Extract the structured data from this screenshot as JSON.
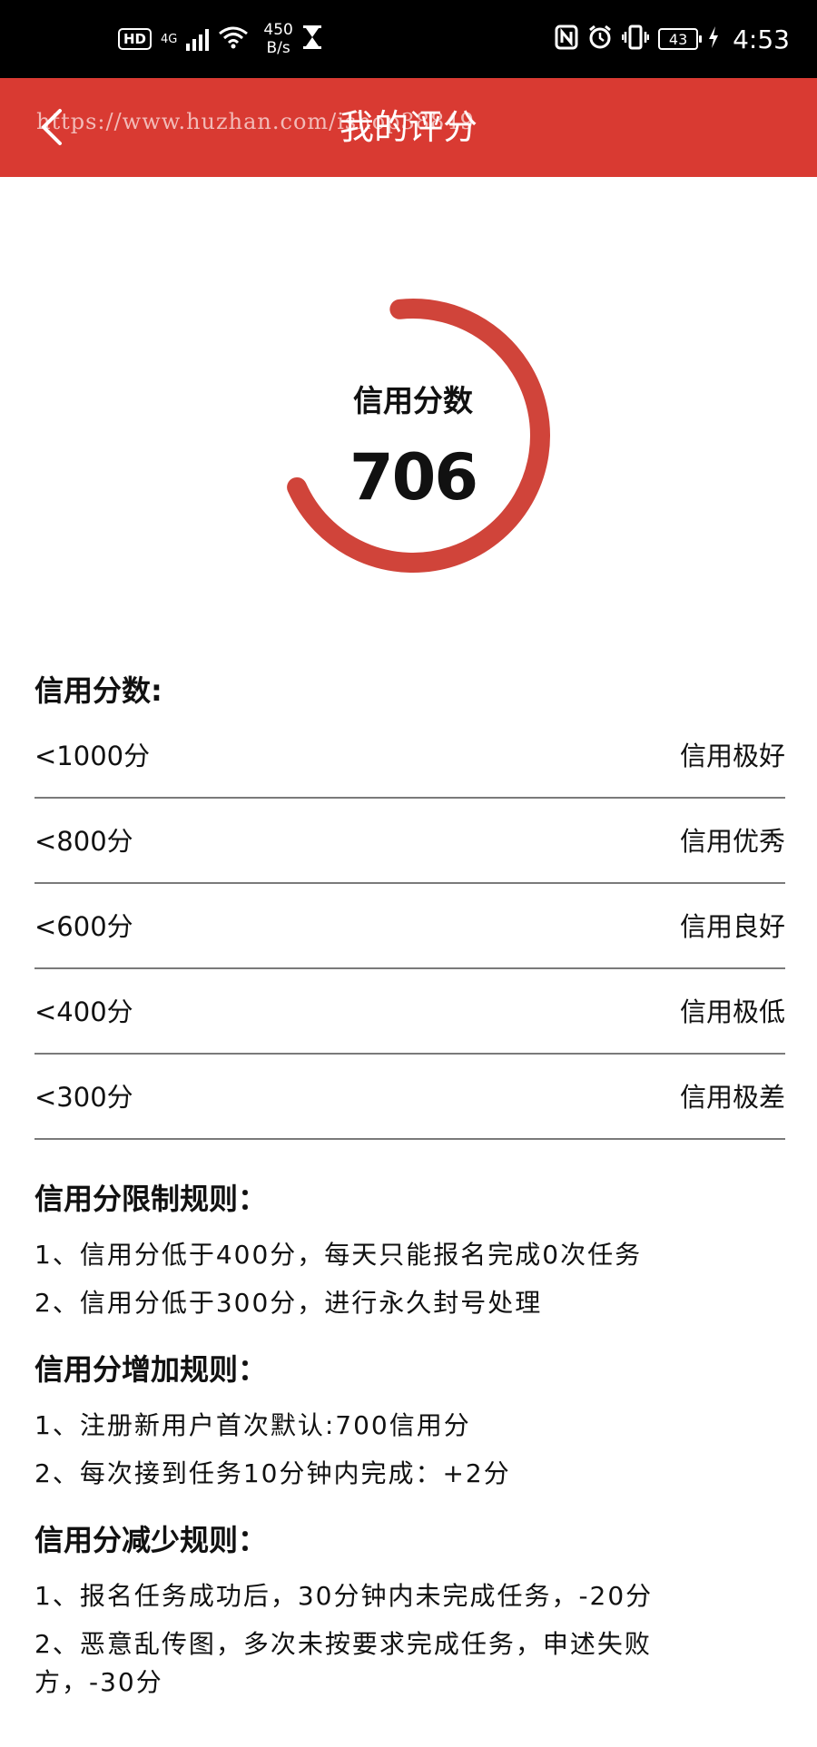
{
  "status_bar": {
    "hd": "HD",
    "network": "4G",
    "speed_value": "450",
    "speed_unit": "B/s",
    "battery": "43",
    "time": "4:53"
  },
  "header": {
    "title": "我的评分",
    "watermark": "https://www.huzhan.com/ishop38849"
  },
  "score": {
    "label": "信用分数",
    "value": "706",
    "ring_fraction": 0.7,
    "ring_color": "#d0443a"
  },
  "levels": {
    "title": "信用分数:",
    "rows": [
      {
        "score": "<1000分",
        "desc": "信用极好"
      },
      {
        "score": "<800分",
        "desc": "信用优秀"
      },
      {
        "score": "<600分",
        "desc": "信用良好"
      },
      {
        "score": "<400分",
        "desc": "信用极低"
      },
      {
        "score": "<300分",
        "desc": "信用极差"
      }
    ]
  },
  "rules": {
    "limit": {
      "title": "信用分限制规则：",
      "items": [
        "1、信用分低于400分，每天只能报名完成0次任务",
        "2、信用分低于300分，进行永久封号处理"
      ]
    },
    "increase": {
      "title": "信用分增加规则：",
      "items": [
        "1、注册新用户首次默认:700信用分",
        "2、每次接到任务10分钟内完成：+2分"
      ]
    },
    "decrease": {
      "title": "信用分减少规则：",
      "items": [
        "1、报名任务成功后，30分钟内未完成任务，-20分",
        "2、恶意乱传图，多次未按要求完成任务，申述失败方，-30分"
      ]
    }
  },
  "colors": {
    "header_bg": "#d93a32",
    "status_bg": "#000000",
    "ring": "#d0443a",
    "divider": "#7a7a7a"
  }
}
